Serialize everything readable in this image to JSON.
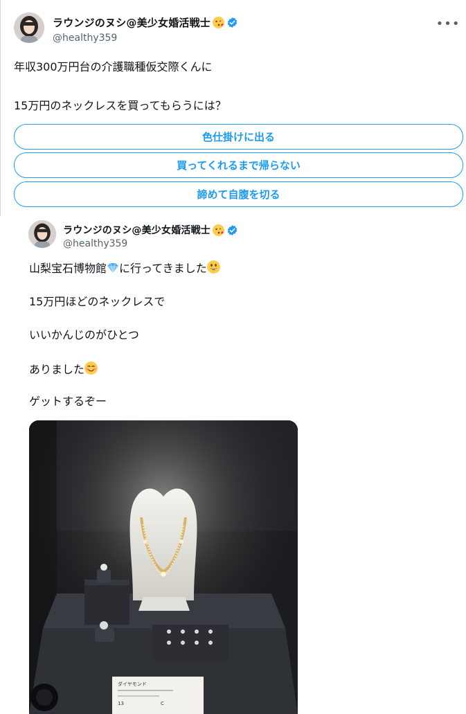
{
  "tweet": {
    "author": {
      "display_name": "ラウンジのヌシ@美少女婚活戦士",
      "handle": "@healthy359",
      "verified": true,
      "name_emoji": "face-blowing-kiss"
    },
    "more_label": "•••",
    "text_line1": "年収300万円台の介護職種仮交際くんに",
    "text_line2": "15万円のネックレスを買ってもらうには？"
  },
  "poll": {
    "options": [
      "色仕掛けに出る",
      "買ってくれるまで帰らない",
      "諦めて自腹を切る"
    ],
    "accent_color": "#1d9bf0"
  },
  "quoted_tweet": {
    "author": {
      "display_name": "ラウンジのヌシ@美少女婚活戦士",
      "handle": "@healthy359",
      "verified": true
    },
    "lines": [
      "山梨宝石博物館",
      "に行ってきました",
      "15万円ほどのネックレスで",
      "いいかんじのがひとつ",
      "ありました",
      "ゲットするぞー"
    ],
    "inline_emoji": [
      "gem-icon",
      "grinning-face-icon",
      "smiling-face-icon"
    ],
    "photo": {
      "description_label_title": "ダイヤモンド",
      "label_value_left": "13",
      "label_value_right": "C"
    }
  },
  "colors": {
    "text": "#0f1419",
    "secondary": "#536471",
    "accent": "#1d9bf0",
    "divider": "#cfd9de"
  }
}
